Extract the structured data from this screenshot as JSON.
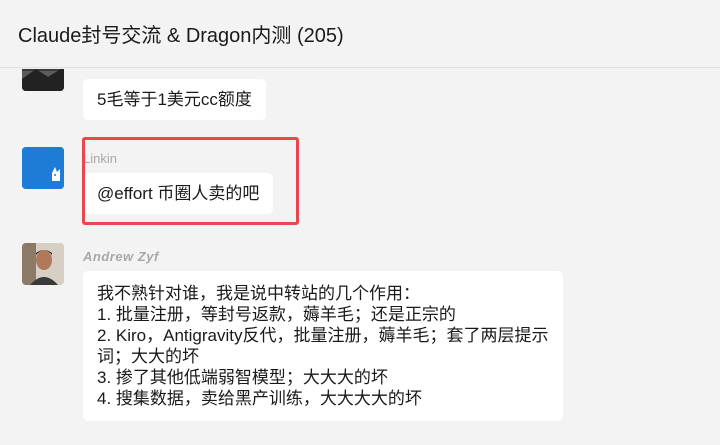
{
  "header": {
    "title": "Claude封号交流 & Dragon内测 (205)"
  },
  "messages": [
    {
      "sender": "",
      "avatar": "dark-landscape-avatar",
      "text": "5毛等于1美元cc额度"
    },
    {
      "sender": "Linkin",
      "avatar": "blue-cat-avatar",
      "text": "@effort 币圈人卖的吧",
      "highlighted": true,
      "highlight_color": "#e8484d"
    },
    {
      "sender": "Andrew Zyf",
      "avatar": "man-portrait-avatar",
      "lines": [
        "我不熟针对谁，我是说中转站的几个作用：",
        "1. 批量注册，等封号返款，薅羊毛；还是正宗的",
        "2. Kiro，Antigravity反代，批量注册，薅羊毛；套了两层提示",
        "词；大大的坏",
        "3. 掺了其他低端弱智模型；大大大的坏",
        "4. 搜集数据，卖给黑产训练，大大大大的坏"
      ]
    }
  ],
  "colors": {
    "background": "#f3f3f3",
    "bubble": "#ffffff",
    "sender_name": "#a8a8a8",
    "avatar_blue": "#1e7bd6"
  }
}
